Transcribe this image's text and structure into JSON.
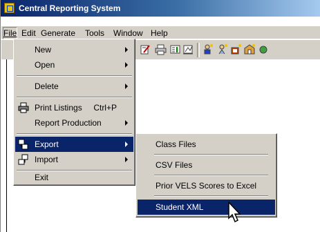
{
  "window": {
    "title": "Central Reporting System"
  },
  "menubar": {
    "items": [
      {
        "label": "File",
        "mnemonic": "F"
      },
      {
        "label": "Edit",
        "mnemonic": "E"
      },
      {
        "label": "Generate",
        "mnemonic": "G"
      },
      {
        "label": "Tools",
        "mnemonic": "T"
      },
      {
        "label": "Window",
        "mnemonic": "W"
      },
      {
        "label": "Help",
        "mnemonic": "H"
      }
    ]
  },
  "file_menu": {
    "items": [
      {
        "label": "New",
        "has_submenu": true
      },
      {
        "label": "Open",
        "has_submenu": true
      },
      {
        "label": "Delete",
        "has_submenu": true
      },
      {
        "label": "Print Listings",
        "shortcut": "Ctrl+P",
        "icon": "printer-icon"
      },
      {
        "label": "Report Production",
        "has_submenu": true
      },
      {
        "label": "Export",
        "has_submenu": true,
        "highlighted": true,
        "icon": "export-icon"
      },
      {
        "label": "Import",
        "has_submenu": true,
        "icon": "import-icon"
      },
      {
        "label": "Exit"
      }
    ]
  },
  "export_submenu": {
    "items": [
      {
        "label": "Class Files"
      },
      {
        "label": "CSV Files"
      },
      {
        "label": "Prior VELS Scores to Excel"
      },
      {
        "label": "Student XML",
        "highlighted": true
      }
    ]
  },
  "colors": {
    "highlight": "#0a246a",
    "menu_bg": "#d4d0c8"
  }
}
